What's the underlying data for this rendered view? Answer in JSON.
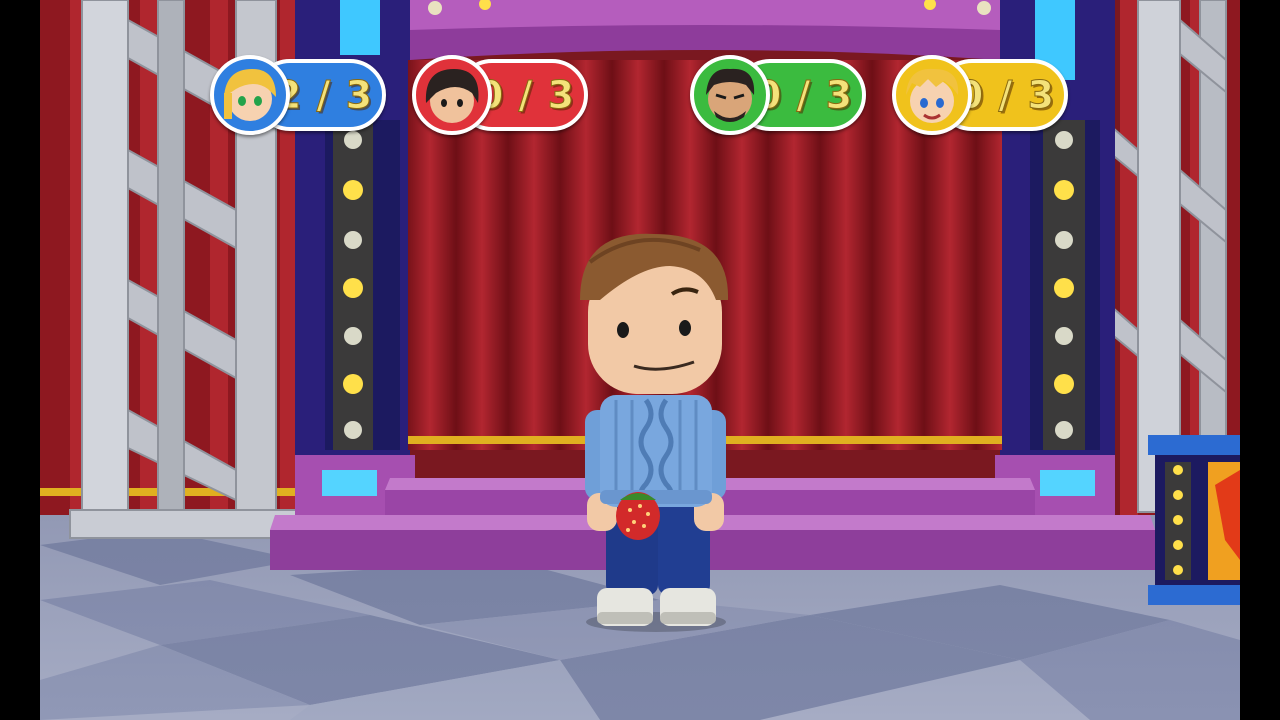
{
  "hud": {
    "players": [
      {
        "score": "2/3",
        "color": "#2f7fe0",
        "icon": "blonde-green-eyed-player-avatar-icon"
      },
      {
        "score": "0/3",
        "color": "#e0323a",
        "icon": "dark-haired-red-player-avatar-icon"
      },
      {
        "score": "0/3",
        "color": "#3bbb3f",
        "icon": "bearded-green-player-avatar-icon"
      },
      {
        "score": "0/3",
        "color": "#f0c21c",
        "icon": "blonde-blue-eyed-player-avatar-icon"
      }
    ]
  },
  "scene": {
    "setting": "game show stage with red curtain",
    "character": "player avatar in blue sweater",
    "held_item": "strawberry",
    "colors": {
      "curtain": "#9a1a22",
      "stage": "#a64fb0",
      "floor_light": "#aab0c8",
      "floor_dark": "#7e87a8",
      "truss": "#c9ccd4"
    }
  }
}
